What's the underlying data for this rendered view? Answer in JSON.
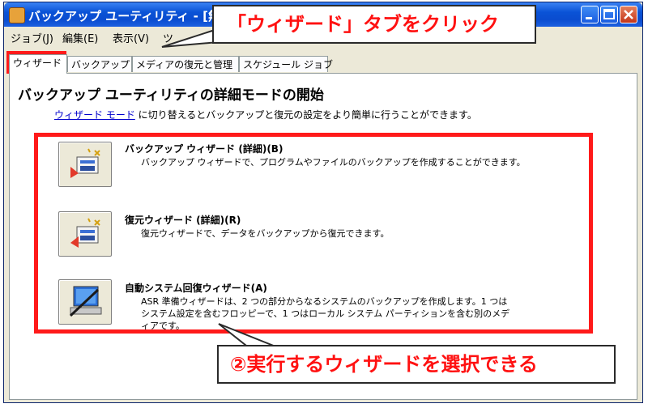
{
  "window": {
    "title": "バックアップ ユーティリティ - [無題]"
  },
  "menu": {
    "items": [
      "ジョブ(J)",
      "編集(E)",
      "表示(V)",
      "ツ"
    ]
  },
  "tabs": [
    {
      "label": "ウィザード"
    },
    {
      "label": "バックアップ"
    },
    {
      "label": "メディアの復元と管理"
    },
    {
      "label": "スケジュール ジョブ"
    }
  ],
  "panel": {
    "heading": "バックアップ ユーティリティの詳細モードの開始",
    "intro_link": "ウィザード モード",
    "intro_text": " に切り替えるとバックアップと復元の設定をより簡単に行うことができます。"
  },
  "wizards": [
    {
      "title": "バックアップ ウィザード (詳細)(B)",
      "description": [
        "バックアップ ウィザードで、プログラムやファイルのバックアップを作成することができます。"
      ],
      "icon": "backup-wizard-icon"
    },
    {
      "title": "復元ウィザード (詳細)(R)",
      "description": [
        "復元ウィザードで、データをバックアップから復元できます。"
      ],
      "icon": "restore-wizard-icon"
    },
    {
      "title": "自動システム回復ウィザード(A)",
      "description": [
        "ASR 準備ウィザードは、2 つの部分からなるシステムのバックアップを作成します。1 つは",
        "システム設定を含むフロッピーで、1 つはローカル システム パーティションを含む別のメデ",
        "ィアです。"
      ],
      "icon": "asr-wizard-icon"
    }
  ],
  "annotations": {
    "top_callout": "「ウィザード」タブをクリック",
    "bottom_callout": "②実行するウィザードを選択できる"
  },
  "colors": {
    "highlight": "#ff1a1a",
    "titlebar": "#0a53d6",
    "window_bg": "#ece9d8"
  }
}
